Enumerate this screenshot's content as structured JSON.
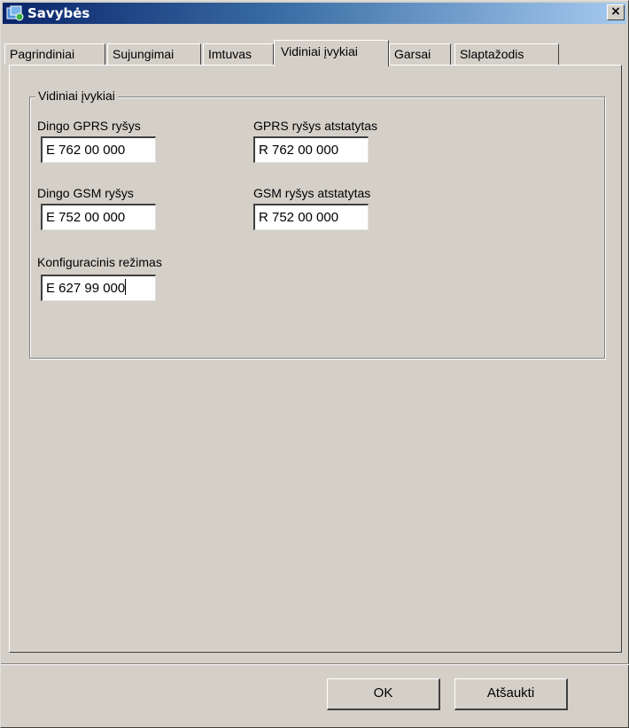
{
  "window": {
    "title": "Savybės",
    "close_glyph": "×"
  },
  "tabs": [
    {
      "label": "Pagrindiniai"
    },
    {
      "label": "Sujungimai"
    },
    {
      "label": "Imtuvas"
    },
    {
      "label": "Vidiniai įvykiai",
      "active": true
    },
    {
      "label": "Garsai"
    },
    {
      "label": "Slaptažodis"
    }
  ],
  "group": {
    "title": "Vidiniai įvykiai",
    "fields": {
      "gprs_lost": {
        "label": "Dingo GPRS ryšys",
        "value": "E 762 00 000"
      },
      "gprs_restored": {
        "label": "GPRS ryšys atstatytas",
        "value": "R 762 00 000"
      },
      "gsm_lost": {
        "label": "Dingo GSM ryšys",
        "value": "E 752 00 000"
      },
      "gsm_restored": {
        "label": "GSM ryšys atstatytas",
        "value": "R 752 00 000"
      },
      "config_mode": {
        "label": "Konfiguracinis režimas",
        "value": "E 627 99 000"
      }
    }
  },
  "buttons": {
    "ok": "OK",
    "cancel": "Atšaukti"
  },
  "icons": {
    "app": "app-window-icon",
    "close": "close-icon"
  },
  "colors": {
    "titlebar_start": "#0a246a",
    "titlebar_end": "#a6caf0",
    "face": "#d4d0c8"
  }
}
